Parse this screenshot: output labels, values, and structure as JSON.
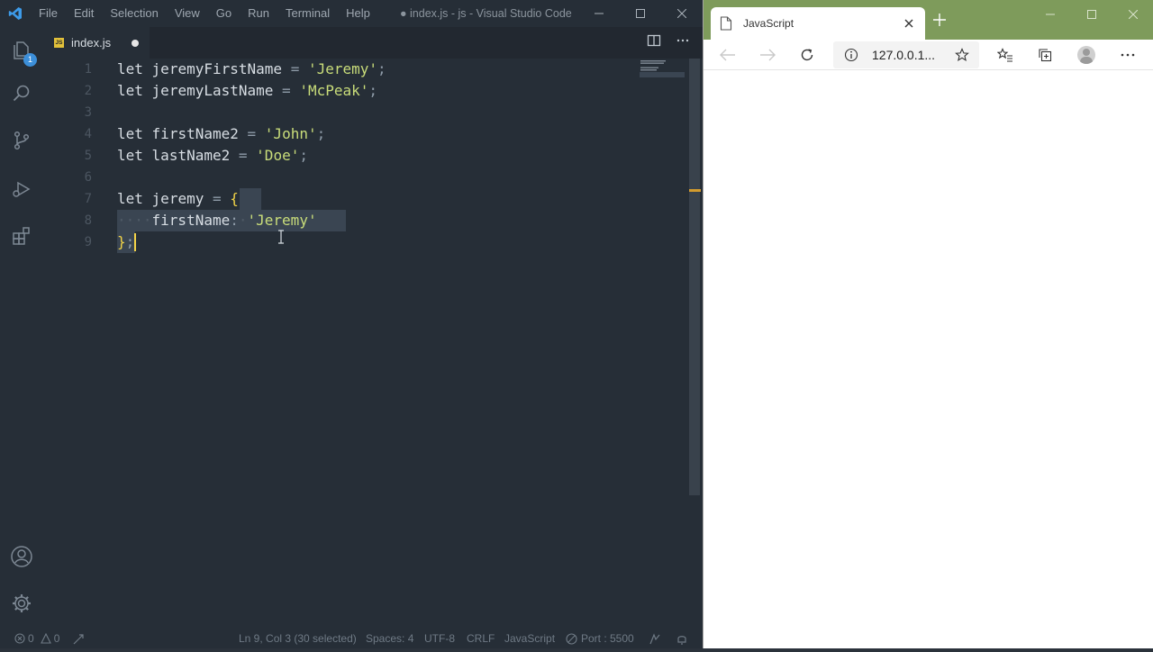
{
  "vscode": {
    "window_title": "● index.js - js - Visual Studio Code",
    "menu": [
      "File",
      "Edit",
      "Selection",
      "View",
      "Go",
      "Run",
      "Terminal",
      "Help"
    ],
    "activity": {
      "explorer_badge": "1",
      "icons": [
        "files-icon",
        "search-icon",
        "source-control-icon",
        "run-debug-icon",
        "extensions-icon",
        "account-icon",
        "gear-icon"
      ]
    },
    "tab": {
      "label": "index.js",
      "file_badge": "JS",
      "dirty": true
    },
    "code_lines": [
      {
        "num": "1",
        "tokens": [
          [
            "kw",
            "let"
          ],
          [
            "sp",
            " "
          ],
          [
            "var",
            "jeremyFirstName"
          ],
          [
            "sp",
            " "
          ],
          [
            "op",
            "="
          ],
          [
            "sp",
            " "
          ],
          [
            "str",
            "'Jeremy'"
          ],
          [
            "op",
            ";"
          ]
        ]
      },
      {
        "num": "2",
        "tokens": [
          [
            "kw",
            "let"
          ],
          [
            "sp",
            " "
          ],
          [
            "var",
            "jeremyLastName"
          ],
          [
            "sp",
            " "
          ],
          [
            "op",
            "="
          ],
          [
            "sp",
            " "
          ],
          [
            "str",
            "'McPeak'"
          ],
          [
            "op",
            ";"
          ]
        ]
      },
      {
        "num": "3",
        "tokens": []
      },
      {
        "num": "4",
        "tokens": [
          [
            "kw",
            "let"
          ],
          [
            "sp",
            " "
          ],
          [
            "var",
            "firstName2"
          ],
          [
            "sp",
            " "
          ],
          [
            "op",
            "="
          ],
          [
            "sp",
            " "
          ],
          [
            "str",
            "'John'"
          ],
          [
            "op",
            ";"
          ]
        ]
      },
      {
        "num": "5",
        "tokens": [
          [
            "kw",
            "let"
          ],
          [
            "sp",
            " "
          ],
          [
            "var",
            "lastName2"
          ],
          [
            "sp",
            " "
          ],
          [
            "op",
            "="
          ],
          [
            "sp",
            " "
          ],
          [
            "str",
            "'Doe'"
          ],
          [
            "op",
            ";"
          ]
        ]
      },
      {
        "num": "6",
        "tokens": []
      },
      {
        "num": "7",
        "tokens": [
          [
            "kw",
            "let"
          ],
          [
            "sp",
            " "
          ],
          [
            "var",
            "jeremy"
          ],
          [
            "sp",
            " "
          ],
          [
            "op",
            "="
          ],
          [
            "sp",
            " "
          ],
          [
            "brace",
            "{"
          ]
        ]
      },
      {
        "num": "8",
        "tokens": [
          [
            "ws",
            "····"
          ],
          [
            "var",
            "firstName"
          ],
          [
            "op",
            ":"
          ],
          [
            "ws",
            "·"
          ],
          [
            "str",
            "'Jeremy'"
          ]
        ]
      },
      {
        "num": "9",
        "tokens": [
          [
            "brace",
            "}"
          ],
          [
            "op",
            ";"
          ]
        ]
      }
    ],
    "status": {
      "errors": "0",
      "warnings": "0",
      "position": "Ln 9, Col 3 (30 selected)",
      "spaces": "Spaces: 4",
      "encoding": "UTF-8",
      "eol": "CRLF",
      "language": "JavaScript",
      "port": "Port : 5500"
    }
  },
  "browser": {
    "tab_title": "JavaScript",
    "url": "127.0.0.1...",
    "accent_color": "#7e9b5b"
  }
}
